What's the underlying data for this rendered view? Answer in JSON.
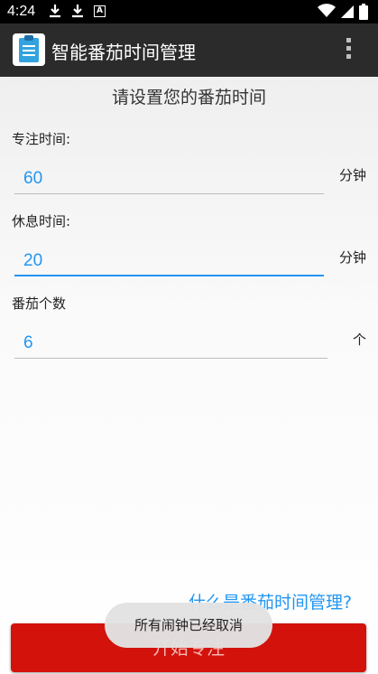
{
  "status_bar": {
    "time": "4:24",
    "icons": [
      "download-icon",
      "download-icon",
      "accessibility-a-icon",
      "wifi-icon",
      "signal-icon",
      "battery-icon"
    ]
  },
  "app_bar": {
    "title": "智能番茄时间管理",
    "icon": "clipboard-icon",
    "menu_icon": "overflow-menu-icon"
  },
  "main": {
    "heading": "请设置您的番茄时间",
    "focus": {
      "label": "专注时间:",
      "value": "60",
      "unit": "分钟"
    },
    "rest": {
      "label": "休息时间:",
      "value": "20",
      "unit": "分钟"
    },
    "count": {
      "label": "番茄个数",
      "value": "6",
      "unit": "个"
    },
    "help_link": "什么是番茄时间管理?",
    "start_button": "开始专注"
  },
  "toast": {
    "text": "所有闹钟已经取消"
  },
  "colors": {
    "accent": "#2196f3",
    "button": "#d3120c",
    "app_bar": "#2b2b2b",
    "status_bar": "#000000"
  }
}
